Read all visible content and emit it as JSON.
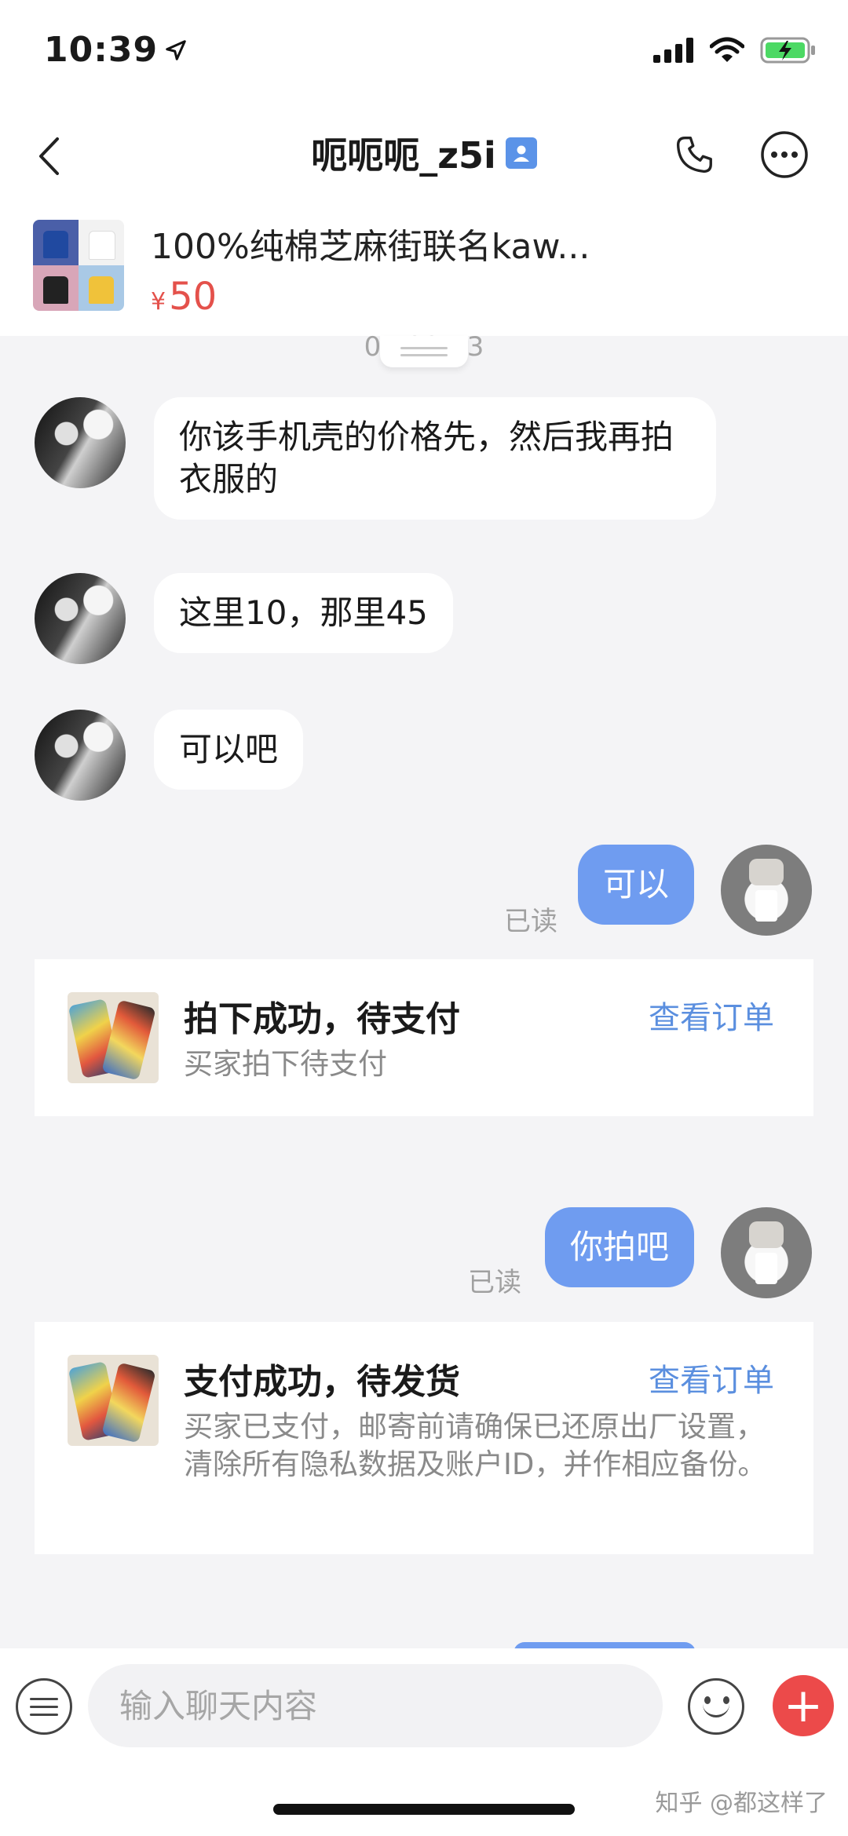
{
  "status_bar": {
    "time": "10:39"
  },
  "header": {
    "title": "呃呃呃_z5i"
  },
  "product": {
    "title": "100%纯棉芝麻街联名kaw...",
    "currency": "¥",
    "price": "50"
  },
  "timestamp": "06:22:53",
  "messages": [
    {
      "from": "them",
      "text": "你该手机壳的价格先，然后我再拍衣服的"
    },
    {
      "from": "them",
      "text": "这里10，那里45"
    },
    {
      "from": "them",
      "text": "可以吧"
    },
    {
      "from": "me",
      "text": "可以",
      "status": "已读"
    },
    {
      "from": "me",
      "text": "你拍吧",
      "status": "已读"
    }
  ],
  "order_cards": [
    {
      "title": "拍下成功，待支付",
      "link": "查看订单",
      "desc": "买家拍下待支付"
    },
    {
      "title": "支付成功，待发货",
      "link": "查看订单",
      "desc": "买家已支付，邮寄前请确保已还原出厂设置，清除所有隐私数据及账户ID，并作相应备份。"
    }
  ],
  "input": {
    "placeholder": "输入聊天内容",
    "value": ""
  },
  "watermark": "知乎 @都这样了",
  "colors": {
    "accent": "#6f9cf0",
    "price": "#e4514b",
    "link": "#5b8fdf",
    "plus": "#ec4a4a"
  },
  "icons": [
    "location-arrow-icon",
    "signal-icon",
    "wifi-icon",
    "battery-charging-icon",
    "back-chevron-icon",
    "contact-card-icon",
    "phone-icon",
    "more-icon",
    "menu-icon",
    "emoji-icon",
    "plus-icon"
  ]
}
